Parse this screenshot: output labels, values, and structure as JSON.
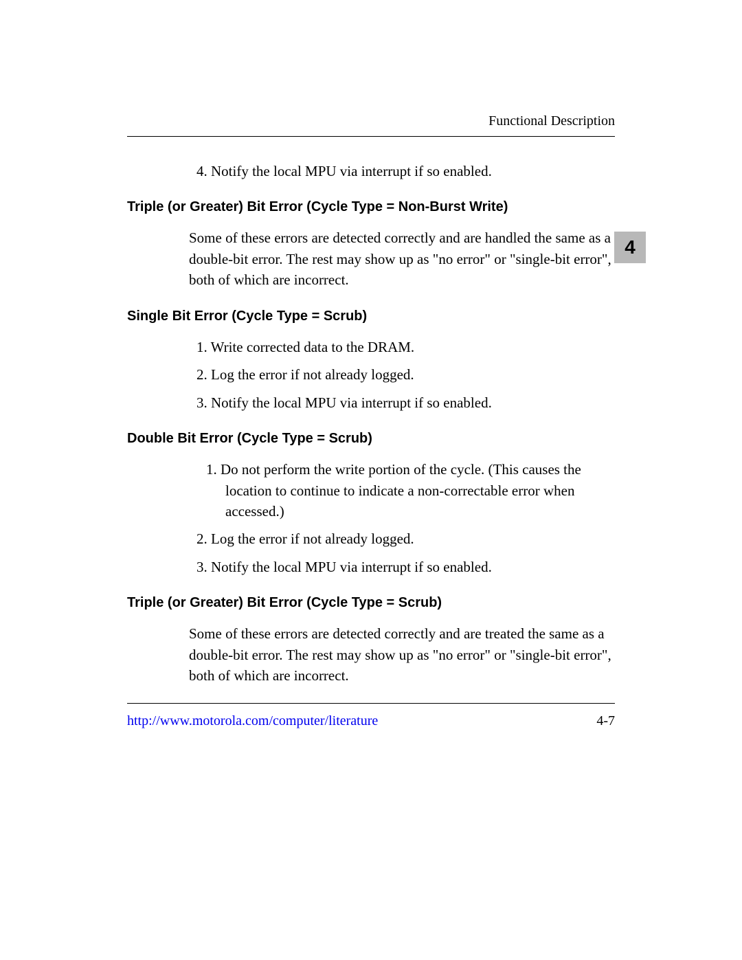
{
  "header": {
    "title": "Functional Description"
  },
  "chapter_tab": "4",
  "sections": {
    "intro_item": "4. Notify the local MPU via interrupt if so enabled.",
    "s1": {
      "heading": "Triple (or Greater) Bit Error (Cycle Type = Non-Burst Write)",
      "para": "Some of these errors are detected correctly and are handled the same as a double-bit error. The rest may show up as \"no error\" or \"single-bit error\", both of which are incorrect."
    },
    "s2": {
      "heading": "Single Bit Error (Cycle Type = Scrub)",
      "items": {
        "i1": "1. Write corrected data to the DRAM.",
        "i2": "2. Log the error if not already logged.",
        "i3": "3. Notify the local MPU via interrupt if so enabled."
      }
    },
    "s3": {
      "heading": "Double Bit Error (Cycle Type = Scrub)",
      "items": {
        "i1": "1. Do not perform the write portion of the cycle. (This causes the location to continue to indicate a non-correctable error when accessed.)",
        "i2": "2. Log the error if not already logged.",
        "i3": "3. Notify the local MPU via interrupt if so enabled."
      }
    },
    "s4": {
      "heading": "Triple (or Greater) Bit Error (Cycle Type = Scrub)",
      "para": "Some of these errors are detected correctly and are treated the same as a double-bit error. The rest may show up as \"no error\" or \"single-bit error\", both of which are incorrect."
    }
  },
  "footer": {
    "link_text": "http://www.motorola.com/computer/literature",
    "page_number": "4-7"
  }
}
